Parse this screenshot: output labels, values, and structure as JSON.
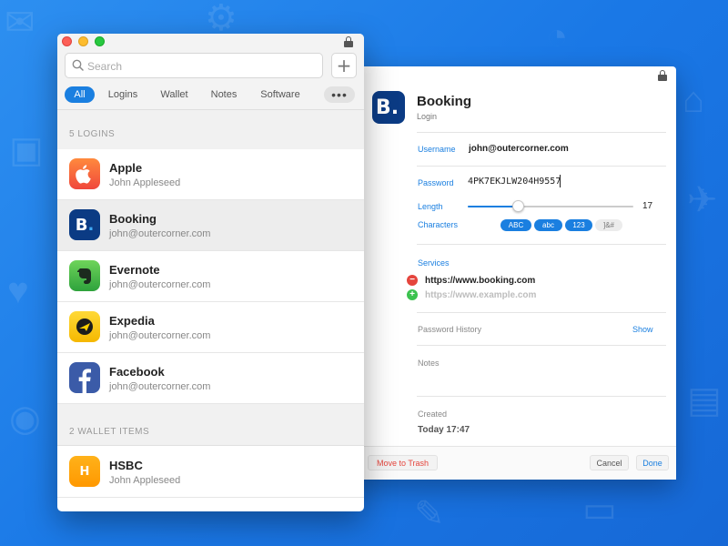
{
  "colors": {
    "accent": "#1a7fe0",
    "background": "#1f7de8",
    "danger": "#e5453d",
    "success": "#3cc24f"
  },
  "list_window": {
    "search": {
      "placeholder": "Search",
      "icon": "search-icon"
    },
    "add_label": "+",
    "tabs": [
      {
        "label": "All",
        "active": true
      },
      {
        "label": "Logins",
        "active": false
      },
      {
        "label": "Wallet",
        "active": false
      },
      {
        "label": "Notes",
        "active": false
      },
      {
        "label": "Software",
        "active": false
      }
    ],
    "more_label": "•••",
    "sections": [
      {
        "title": "5 LOGINS",
        "items": [
          {
            "title": "Apple",
            "subtitle": "John Appleseed",
            "icon": "apple-icon",
            "selected": false
          },
          {
            "title": "Booking",
            "subtitle": "john@outercorner.com",
            "icon": "booking-icon",
            "selected": true
          },
          {
            "title": "Evernote",
            "subtitle": "john@outercorner.com",
            "icon": "evernote-icon",
            "selected": false
          },
          {
            "title": "Expedia",
            "subtitle": "john@outercorner.com",
            "icon": "expedia-icon",
            "selected": false
          },
          {
            "title": "Facebook",
            "subtitle": "john@outercorner.com",
            "icon": "facebook-icon",
            "selected": false
          }
        ]
      },
      {
        "title": "2 WALLET ITEMS",
        "items": [
          {
            "title": "HSBC",
            "subtitle": "John Appleseed",
            "icon": "hsbc-icon",
            "icon_letter": "H",
            "selected": false
          }
        ]
      }
    ]
  },
  "detail_window": {
    "logo_letter": "B.",
    "title": "Booking",
    "subtitle": "Login",
    "username": {
      "label": "Username",
      "value": "john@outercorner.com"
    },
    "password": {
      "label": "Password",
      "value": "4PK7EKJLW204H9557"
    },
    "length": {
      "label": "Length",
      "value": "17",
      "fraction": 0.3
    },
    "characters": {
      "label": "Characters",
      "options": [
        {
          "label": "ABC",
          "on": true
        },
        {
          "label": "abc",
          "on": true
        },
        {
          "label": "123",
          "on": true
        },
        {
          "label": "]&#",
          "on": false
        }
      ]
    },
    "services": {
      "label": "Services",
      "items": [
        {
          "url": "https://www.booking.com",
          "action": "remove"
        },
        {
          "url": "https://www.example.com",
          "action": "add",
          "placeholder": true
        }
      ]
    },
    "password_history": {
      "label": "Password History",
      "action": "Show"
    },
    "notes": {
      "label": "Notes"
    },
    "created": {
      "label": "Created",
      "value": "Today 17:47"
    },
    "footer": {
      "trash": "Move to Trash",
      "cancel": "Cancel",
      "done": "Done"
    }
  }
}
